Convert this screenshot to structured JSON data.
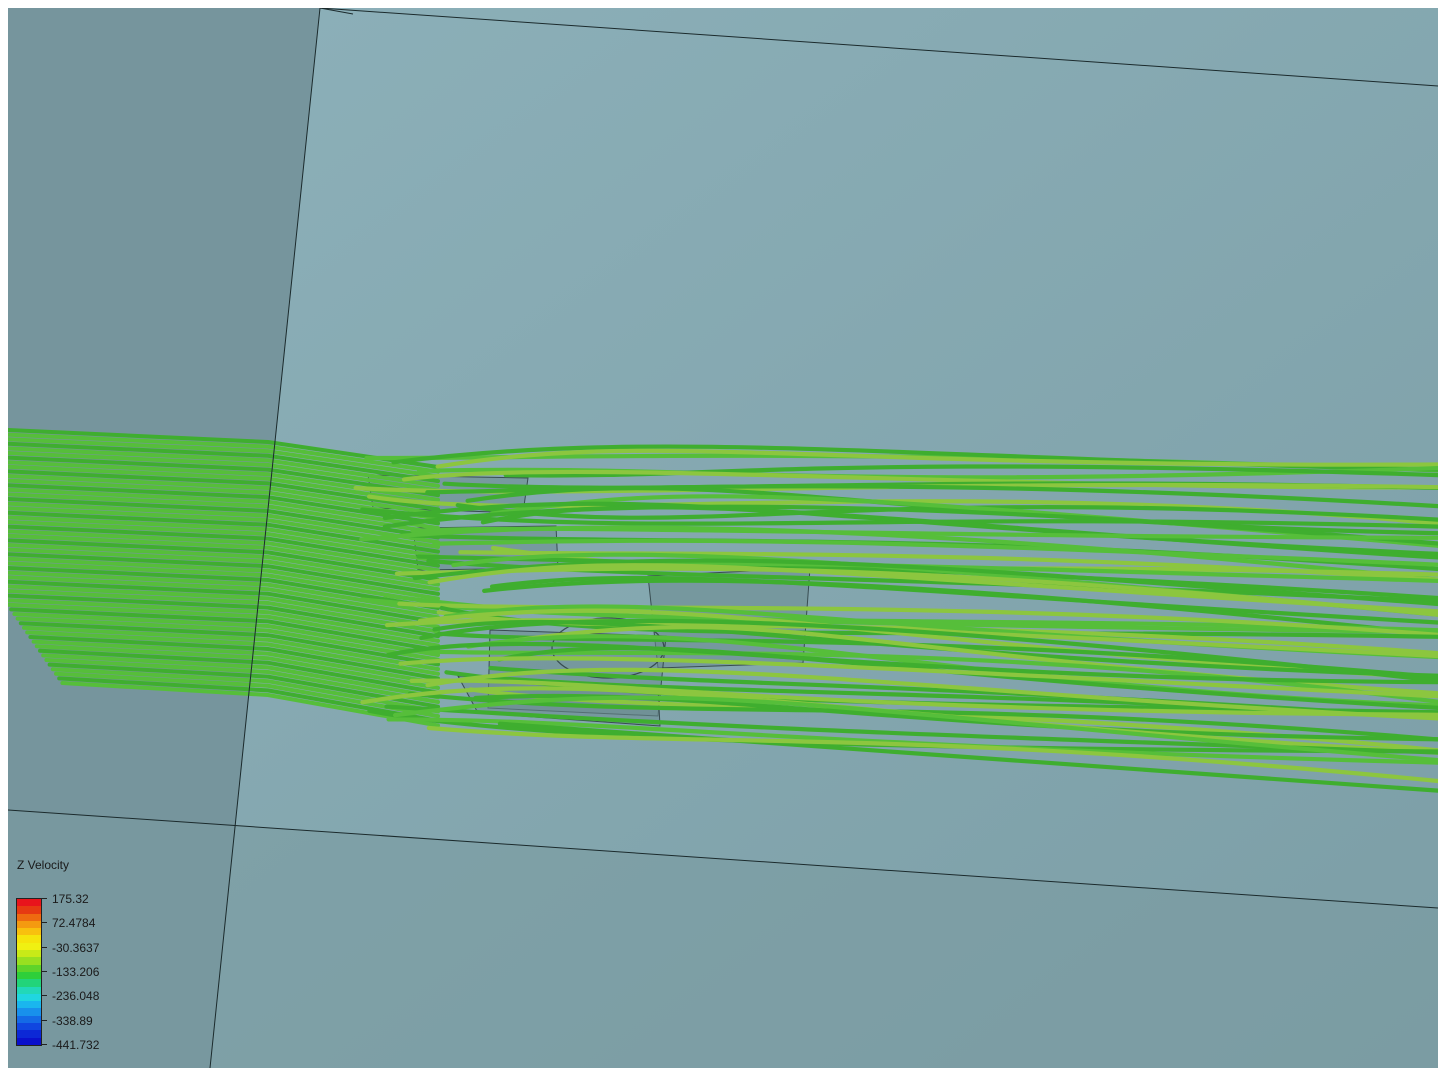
{
  "colors": {
    "background_side": "#7a979f",
    "background_main": "#83a6b0",
    "floor": "#79999f",
    "streamline_base": "#56be3a",
    "streamline_dark": "#3fae2f",
    "streamline_light": "#8cc63f",
    "body": "#6b8c90",
    "edge": "#1b2a2c"
  },
  "legend": {
    "title": "Z Velocity",
    "range": [
      -441.732,
      175.32
    ],
    "ticks": [
      "175.32",
      "72.4784",
      "-30.3637",
      "-133.206",
      "-236.048",
      "-338.89",
      "-441.732"
    ],
    "colormap": [
      "#e8141c",
      "#e63a12",
      "#ee6a10",
      "#f49a10",
      "#f8c00e",
      "#f5e40c",
      "#f0f012",
      "#c8ea18",
      "#98e020",
      "#5ed42a",
      "#2ecf3a",
      "#22d47a",
      "#22d8b8",
      "#20d6e0",
      "#1ab6ee",
      "#1890ec",
      "#146ae6",
      "#1046e0",
      "#0c28d6",
      "#0a10cc"
    ]
  }
}
